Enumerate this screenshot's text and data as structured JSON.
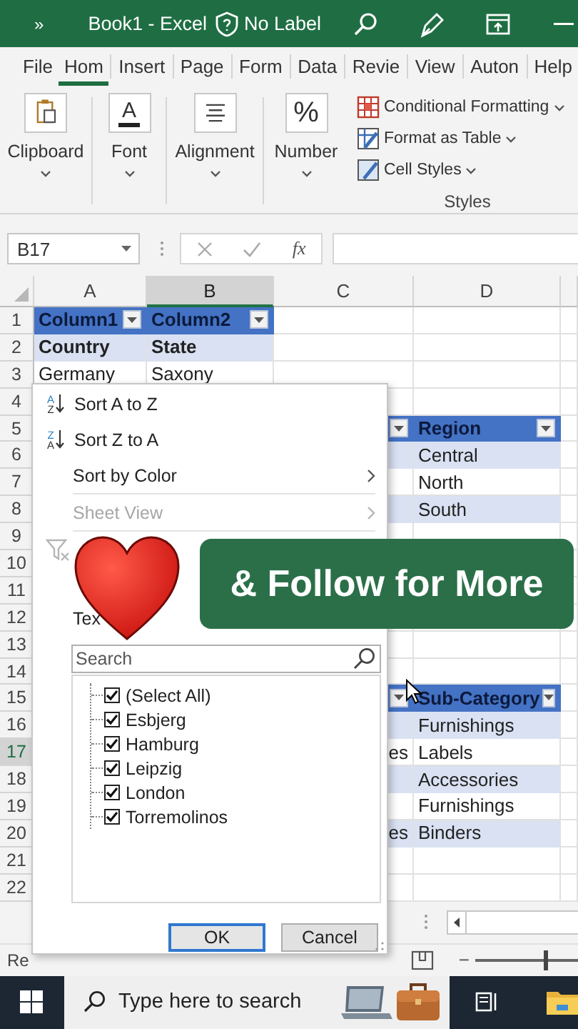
{
  "title_bar": {
    "quick_access": "»",
    "title": "Book1 - Excel",
    "label": "No Label"
  },
  "ribbon_tabs": [
    {
      "label": "File",
      "selected": false
    },
    {
      "label": "Hom",
      "selected": true
    },
    {
      "label": "Insert",
      "selected": false
    },
    {
      "label": "Page",
      "selected": false
    },
    {
      "label": "Form",
      "selected": false
    },
    {
      "label": "Data",
      "selected": false
    },
    {
      "label": "Revie",
      "selected": false
    },
    {
      "label": "View",
      "selected": false
    },
    {
      "label": "Auton",
      "selected": false
    },
    {
      "label": "Help",
      "selected": false
    }
  ],
  "ribbon_groups": [
    {
      "label": "Clipboard"
    },
    {
      "label": "Font",
      "glyph": "A"
    },
    {
      "label": "Alignment"
    },
    {
      "label": "Number",
      "glyph": "%"
    }
  ],
  "styles_group": {
    "items": [
      "Conditional Formatting",
      "Format as Table",
      "Cell Styles"
    ],
    "label": "Styles"
  },
  "formula_bar": {
    "name_box": "B17",
    "function": "fx"
  },
  "sheet": {
    "columns": [
      {
        "label": "A",
        "selected": false
      },
      {
        "label": "B",
        "selected": true
      },
      {
        "label": "C",
        "selected": false
      },
      {
        "label": "D",
        "selected": false
      }
    ],
    "rows": [
      {
        "number": "1",
        "selected": false,
        "cells": [
          {
            "kind": "header",
            "text": "Column1"
          },
          {
            "kind": "header",
            "text": "Column2"
          },
          {
            "kind": "plain"
          },
          {
            "kind": "plain"
          }
        ]
      },
      {
        "number": "2",
        "selected": false,
        "cells": [
          {
            "kind": "subheader",
            "text": "Country"
          },
          {
            "kind": "subheader",
            "text": "State"
          },
          {
            "kind": "plain"
          },
          {
            "kind": "plain"
          }
        ]
      },
      {
        "number": "3",
        "selected": false,
        "cells": [
          {
            "kind": "plain",
            "text": "Germany"
          },
          {
            "kind": "plain",
            "text": "Saxony"
          },
          {
            "kind": "plain"
          },
          {
            "kind": "plain"
          }
        ]
      },
      {
        "number": "4",
        "selected": false,
        "cells": [
          {
            "kind": "plain"
          },
          {
            "kind": "plain"
          }
        ]
      },
      {
        "number": "5",
        "selected": false,
        "cells": [
          {
            "kind": "header"
          },
          {
            "kind": "header",
            "text": "Region"
          }
        ]
      },
      {
        "number": "6",
        "selected": false,
        "cells": [
          {
            "kind": "band"
          },
          {
            "kind": "band",
            "text": "Central"
          }
        ]
      },
      {
        "number": "7",
        "selected": false,
        "cells": [
          {
            "kind": "plain"
          },
          {
            "kind": "plain",
            "text": "North"
          }
        ]
      },
      {
        "number": "8",
        "selected": false,
        "cells": [
          {
            "kind": "band"
          },
          {
            "kind": "band",
            "text": "South"
          }
        ]
      },
      {
        "number": "9",
        "selected": false,
        "cells": [
          {
            "kind": "plain"
          },
          {
            "kind": "plain"
          }
        ]
      },
      {
        "number": "10",
        "selected": false
      },
      {
        "number": "11",
        "selected": false
      },
      {
        "number": "12",
        "selected": false
      },
      {
        "number": "13",
        "selected": false,
        "cells": [
          {
            "kind": "plain"
          },
          {
            "kind": "plain"
          }
        ]
      },
      {
        "number": "14",
        "selected": false,
        "cells": [
          {
            "kind": "plain"
          },
          {
            "kind": "plain"
          }
        ]
      },
      {
        "number": "15",
        "selected": false,
        "cells": [
          {
            "kind": "header"
          },
          {
            "kind": "header",
            "text": "Sub-Category"
          }
        ]
      },
      {
        "number": "16",
        "selected": false,
        "cells": [
          {
            "kind": "band"
          },
          {
            "kind": "band",
            "text": "Furnishings"
          }
        ]
      },
      {
        "number": "17",
        "selected": true,
        "cells": [
          {
            "kind": "plain",
            "text": "es"
          },
          {
            "kind": "plain",
            "text": "Labels"
          }
        ]
      },
      {
        "number": "18",
        "selected": false,
        "cells": [
          {
            "kind": "band"
          },
          {
            "kind": "band",
            "text": "Accessories"
          }
        ]
      },
      {
        "number": "19",
        "selected": false,
        "cells": [
          {
            "kind": "plain"
          },
          {
            "kind": "plain",
            "text": "Furnishings"
          }
        ]
      },
      {
        "number": "20",
        "selected": false,
        "cells": [
          {
            "kind": "band",
            "text": "es"
          },
          {
            "kind": "band",
            "text": "Binders"
          }
        ]
      },
      {
        "number": "21",
        "selected": false,
        "cells": [
          {
            "kind": "plain"
          },
          {
            "kind": "plain"
          }
        ]
      },
      {
        "number": "22",
        "selected": false,
        "cells": [
          {
            "kind": "plain"
          },
          {
            "kind": "plain"
          }
        ]
      }
    ]
  },
  "filter_menu": {
    "items": [
      {
        "kind": "sort",
        "icon_letters": [
          "A",
          "Z"
        ],
        "label": "Sort A to Z",
        "disabled": false,
        "submenu": false
      },
      {
        "kind": "sort",
        "icon_letters": [
          "Z",
          "A"
        ],
        "label": "Sort Z to A",
        "disabled": false,
        "submenu": false
      },
      {
        "kind": "command",
        "label": "Sort by Color",
        "disabled": false,
        "submenu": true
      },
      {
        "kind": "separator"
      },
      {
        "kind": "command",
        "label": "Sheet View",
        "disabled": true,
        "submenu": true
      },
      {
        "kind": "separator"
      },
      {
        "kind": "clear-filter",
        "disabled": true
      },
      {
        "kind": "text-filters",
        "label": "Tex",
        "disabled": false
      }
    ],
    "search": {
      "placeholder": "Search"
    },
    "values": [
      {
        "label": "(Select All)",
        "checked": true
      },
      {
        "label": "Esbjerg",
        "checked": true
      },
      {
        "label": "Hamburg",
        "checked": true
      },
      {
        "label": "Leipzig",
        "checked": true
      },
      {
        "label": "London",
        "checked": true
      },
      {
        "label": "Torremolinos",
        "checked": true
      }
    ],
    "buttons": [
      {
        "label": "OK",
        "selected": true
      },
      {
        "label": "Cancel",
        "selected": false
      }
    ]
  },
  "overlay": {
    "banner": "& Follow for More"
  },
  "status_bar": {
    "text": "Re",
    "zoom": {
      "minus": "−",
      "level": 0.67
    }
  },
  "taskbar": {
    "search_placeholder": "Type here to search"
  }
}
